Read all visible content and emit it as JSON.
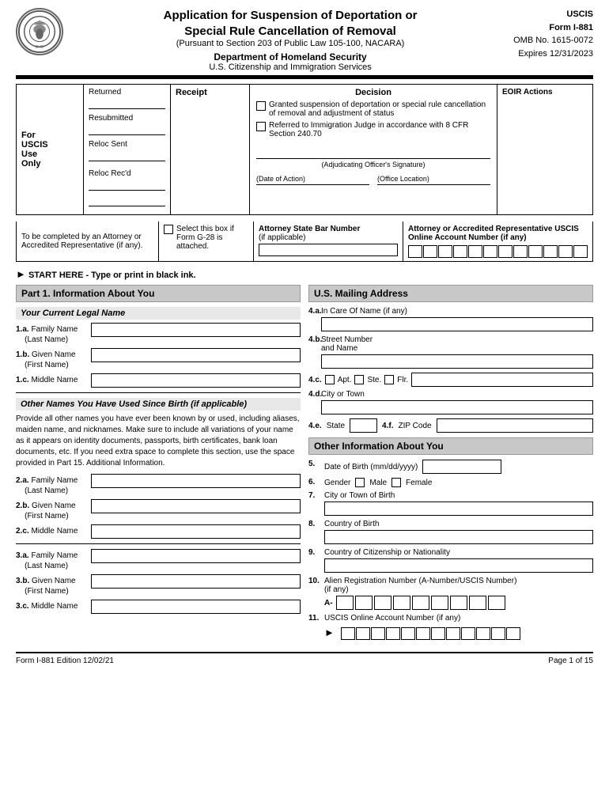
{
  "header": {
    "title_line1": "Application for Suspension of Deportation or",
    "title_line2": "Special Rule Cancellation of Removal",
    "subtitle": "(Pursuant to Section 203 of Public Law 105-100, NACARA)",
    "department": "Department of Homeland Security",
    "agency": "U.S. Citizenship and Immigration Services",
    "form_agency": "USCIS",
    "form_name": "Form I-881",
    "omb": "OMB No. 1615-0072",
    "expires": "Expires 12/31/2023",
    "logo_text": "U.S. DHS"
  },
  "uscis_box": {
    "for_label": "For\nUSCIS\nUse\nOnly",
    "returned_label": "Returned",
    "resubmitted_label": "Resubmitted",
    "reloc_sent_label": "Reloc Sent",
    "reloc_recd_label": "Reloc Rec'd",
    "receipt_label": "Receipt",
    "decision_title": "Decision",
    "decision1": "Granted suspension of deportation or special rule cancellation of removal and adjustment of status",
    "decision2": "Referred to Immigration Judge in accordance with 8 CFR Section 240.70",
    "sig_label": "(Adjudicating Officer's Signature)",
    "date_label": "(Date of Action)",
    "office_label": "(Office Location)",
    "eoir_title": "EOIR Actions"
  },
  "attorney_box": {
    "col1_text": "To be completed by an Attorney or Accredited Representative (if any).",
    "col2_label": "Select this box if Form G-28 is attached.",
    "col3_title": "Attorney State Bar Number",
    "col3_sub": "(if applicable)",
    "col4_title": "Attorney or Accredited Representative USCIS Online Account Number (if any)"
  },
  "start_here": {
    "text": "START HERE - Type or print in black ink."
  },
  "part1": {
    "title": "Part 1.  Information About You",
    "current_name_title": "Your Current Legal Name",
    "field_1a_num": "1.a.",
    "field_1a_label": "Family Name\n(Last Name)",
    "field_1b_num": "1.b.",
    "field_1b_label": "Given Name\n(First Name)",
    "field_1c_num": "1.c.",
    "field_1c_label": "Middle Name",
    "other_names_title": "Other Names You Have Used Since Birth (if applicable)",
    "other_names_text": "Provide all other names you have ever been known by or used, including aliases, maiden name, and nicknames.  Make sure to include all variations of your name as it appears on identity documents, passports, birth certificates, bank loan documents, etc.  If you need extra space to complete this section, use the space provided in Part 15. Additional Information.",
    "field_2a_num": "2.a.",
    "field_2a_label": "Family Name\n(Last Name)",
    "field_2b_num": "2.b.",
    "field_2b_label": "Given Name\n(First Name)",
    "field_2c_num": "2.c.",
    "field_2c_label": "Middle Name",
    "field_3a_num": "3.a.",
    "field_3a_label": "Family Name\n(Last Name)",
    "field_3b_num": "3.b.",
    "field_3b_label": "Given Name\n(First Name)",
    "field_3c_num": "3.c.",
    "field_3c_label": "Middle Name"
  },
  "mailing_address": {
    "title": "U.S. Mailing Address",
    "field_4a_num": "4.a.",
    "field_4a_label": "In Care Of Name (if any)",
    "field_4b_num": "4.b.",
    "field_4b_label1": "Street Number",
    "field_4b_label2": "and Name",
    "field_4c_num": "4.c.",
    "apt_label": "Apt.",
    "ste_label": "Ste.",
    "flr_label": "Flr.",
    "field_4d_num": "4.d.",
    "field_4d_label": "City or Town",
    "field_4e_num": "4.e.",
    "field_4e_label": "State",
    "field_4f_num": "4.f.",
    "field_4f_label": "ZIP Code"
  },
  "other_info": {
    "title": "Other Information About You",
    "field_5_num": "5.",
    "field_5_label": "Date of Birth (mm/dd/yyyy)",
    "field_6_num": "6.",
    "field_6_label": "Gender",
    "male_label": "Male",
    "female_label": "Female",
    "field_7_num": "7.",
    "field_7_label": "City or Town of Birth",
    "field_8_num": "8.",
    "field_8_label": "Country of Birth",
    "field_9_num": "9.",
    "field_9_label": "Country of Citizenship or Nationality",
    "field_10_num": "10.",
    "field_10_label": "Alien Registration Number (A-Number/USCIS Number)",
    "field_10_sub": "(if any)",
    "a_prefix": "A-",
    "field_11_num": "11.",
    "field_11_label": "USCIS Online Account Number (if any)"
  },
  "footer": {
    "left": "Form I-881  Edition  12/02/21",
    "right": "Page 1 of 15"
  }
}
